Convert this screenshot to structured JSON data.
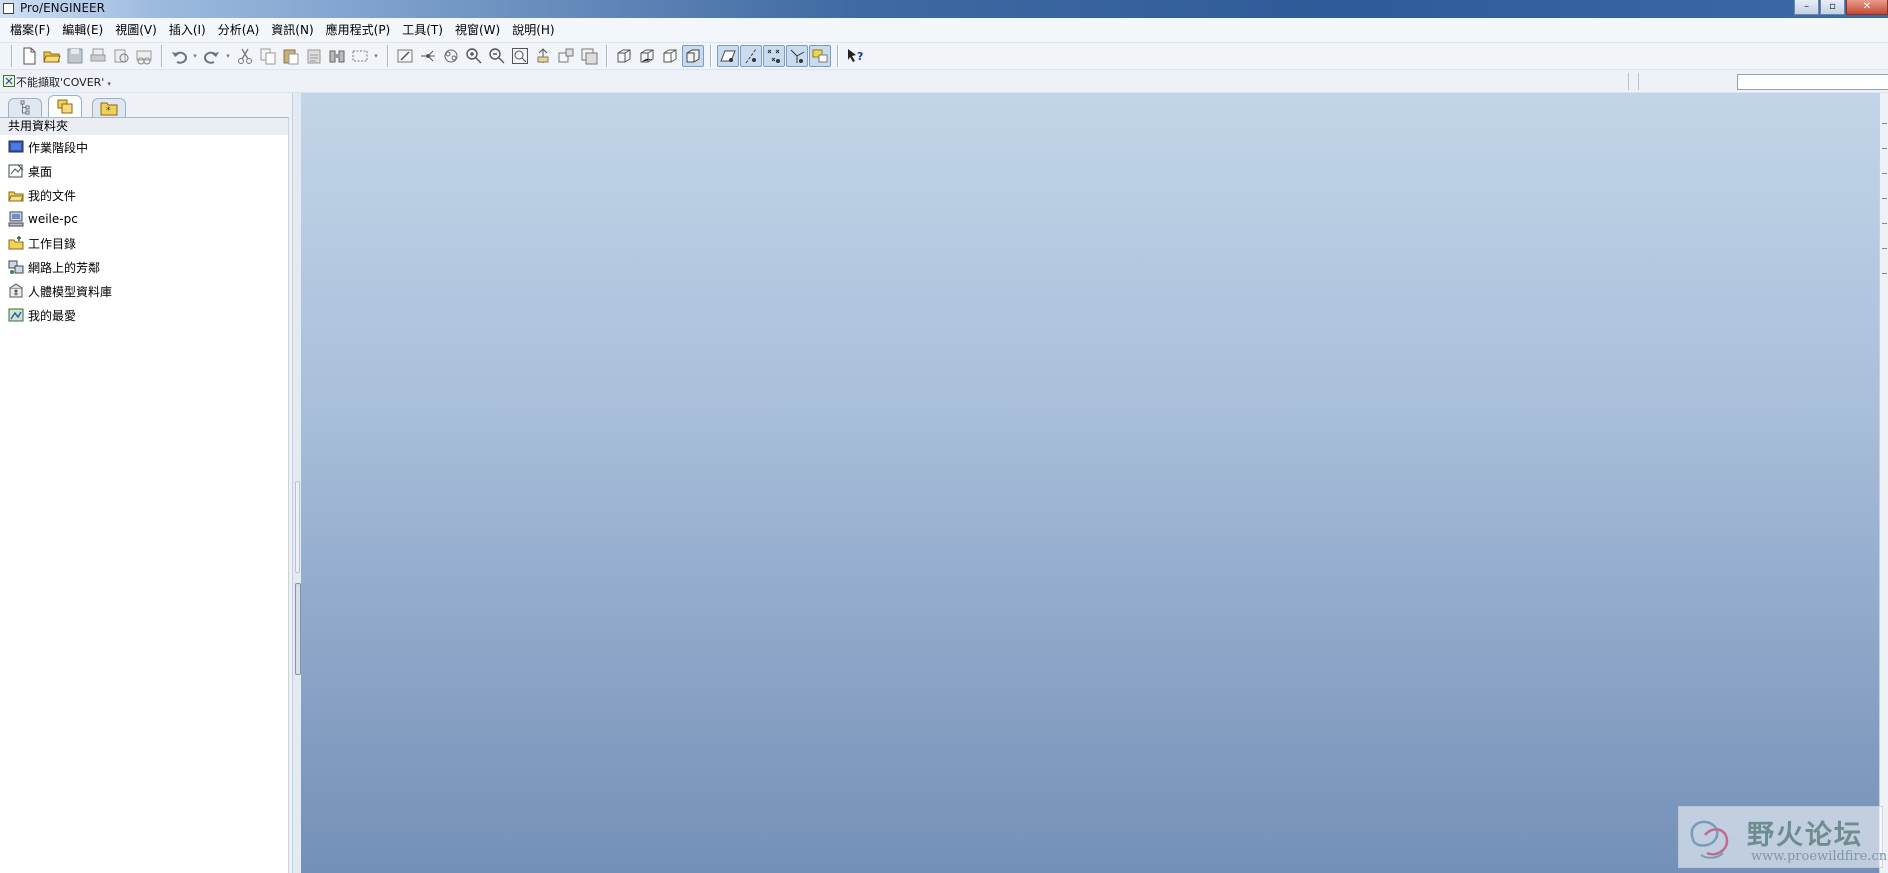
{
  "window": {
    "title": "Pro/ENGINEER",
    "controls": [
      "–",
      "▫",
      "✕"
    ]
  },
  "menu": [
    {
      "label": "檔案(F)"
    },
    {
      "label": "編輯(E)"
    },
    {
      "label": "視圖(V)"
    },
    {
      "label": "插入(I)"
    },
    {
      "label": "分析(A)"
    },
    {
      "label": "資訊(N)"
    },
    {
      "label": "應用程式(P)"
    },
    {
      "label": "工具(T)"
    },
    {
      "label": "視窗(W)"
    },
    {
      "label": "說明(H)"
    }
  ],
  "toolbar": {
    "groups": [
      [
        "new-file-icon",
        "open-folder-icon",
        "save-icon",
        "print-icon",
        "print-preview-icon",
        "send-mail-icon"
      ],
      [
        "undo-icon",
        "redo-icon",
        "cut-icon",
        "copy-icon",
        "paste-icon",
        "paste-special-icon",
        "regenerate-icon",
        "select-box-icon"
      ],
      [
        "repaint-icon",
        "spin-center-icon",
        "orient-icon",
        "zoom-in-icon",
        "zoom-out-icon",
        "refit-icon",
        "reorient-icon",
        "saved-views-icon",
        "layers-icon"
      ],
      [
        "wireframe-icon",
        "hidden-line-icon",
        "no-hidden-icon",
        "shading-icon"
      ],
      [
        "datum-planes-icon",
        "datum-axes-icon",
        "datum-points-icon",
        "coord-systems-icon",
        "annotations-icon"
      ],
      [
        "context-help-icon"
      ]
    ]
  },
  "status": {
    "text": "不能擷取'COVER'",
    "arrow": "▾",
    "search_placeholder": ""
  },
  "navigator": {
    "tabs": [
      "model-tree-tab",
      "folder-browser-tab",
      "favorites-tab"
    ],
    "header": "共用資料夾",
    "items": [
      {
        "label": "作業階段中",
        "icon": "session-icon"
      },
      {
        "label": "桌面",
        "icon": "desktop-icon"
      },
      {
        "label": "我的文件",
        "icon": "documents-icon"
      },
      {
        "label": "weile-pc",
        "icon": "computer-icon"
      },
      {
        "label": "工作目錄",
        "icon": "working-directory-icon"
      },
      {
        "label": "網路上的芳鄰",
        "icon": "network-icon"
      },
      {
        "label": "人體模型資料庫",
        "icon": "manikin-library-icon"
      },
      {
        "label": "我的最愛",
        "icon": "favorites-icon"
      }
    ]
  },
  "watermark": {
    "brand": "野火论坛",
    "url": "www.proewildfire.cn"
  }
}
